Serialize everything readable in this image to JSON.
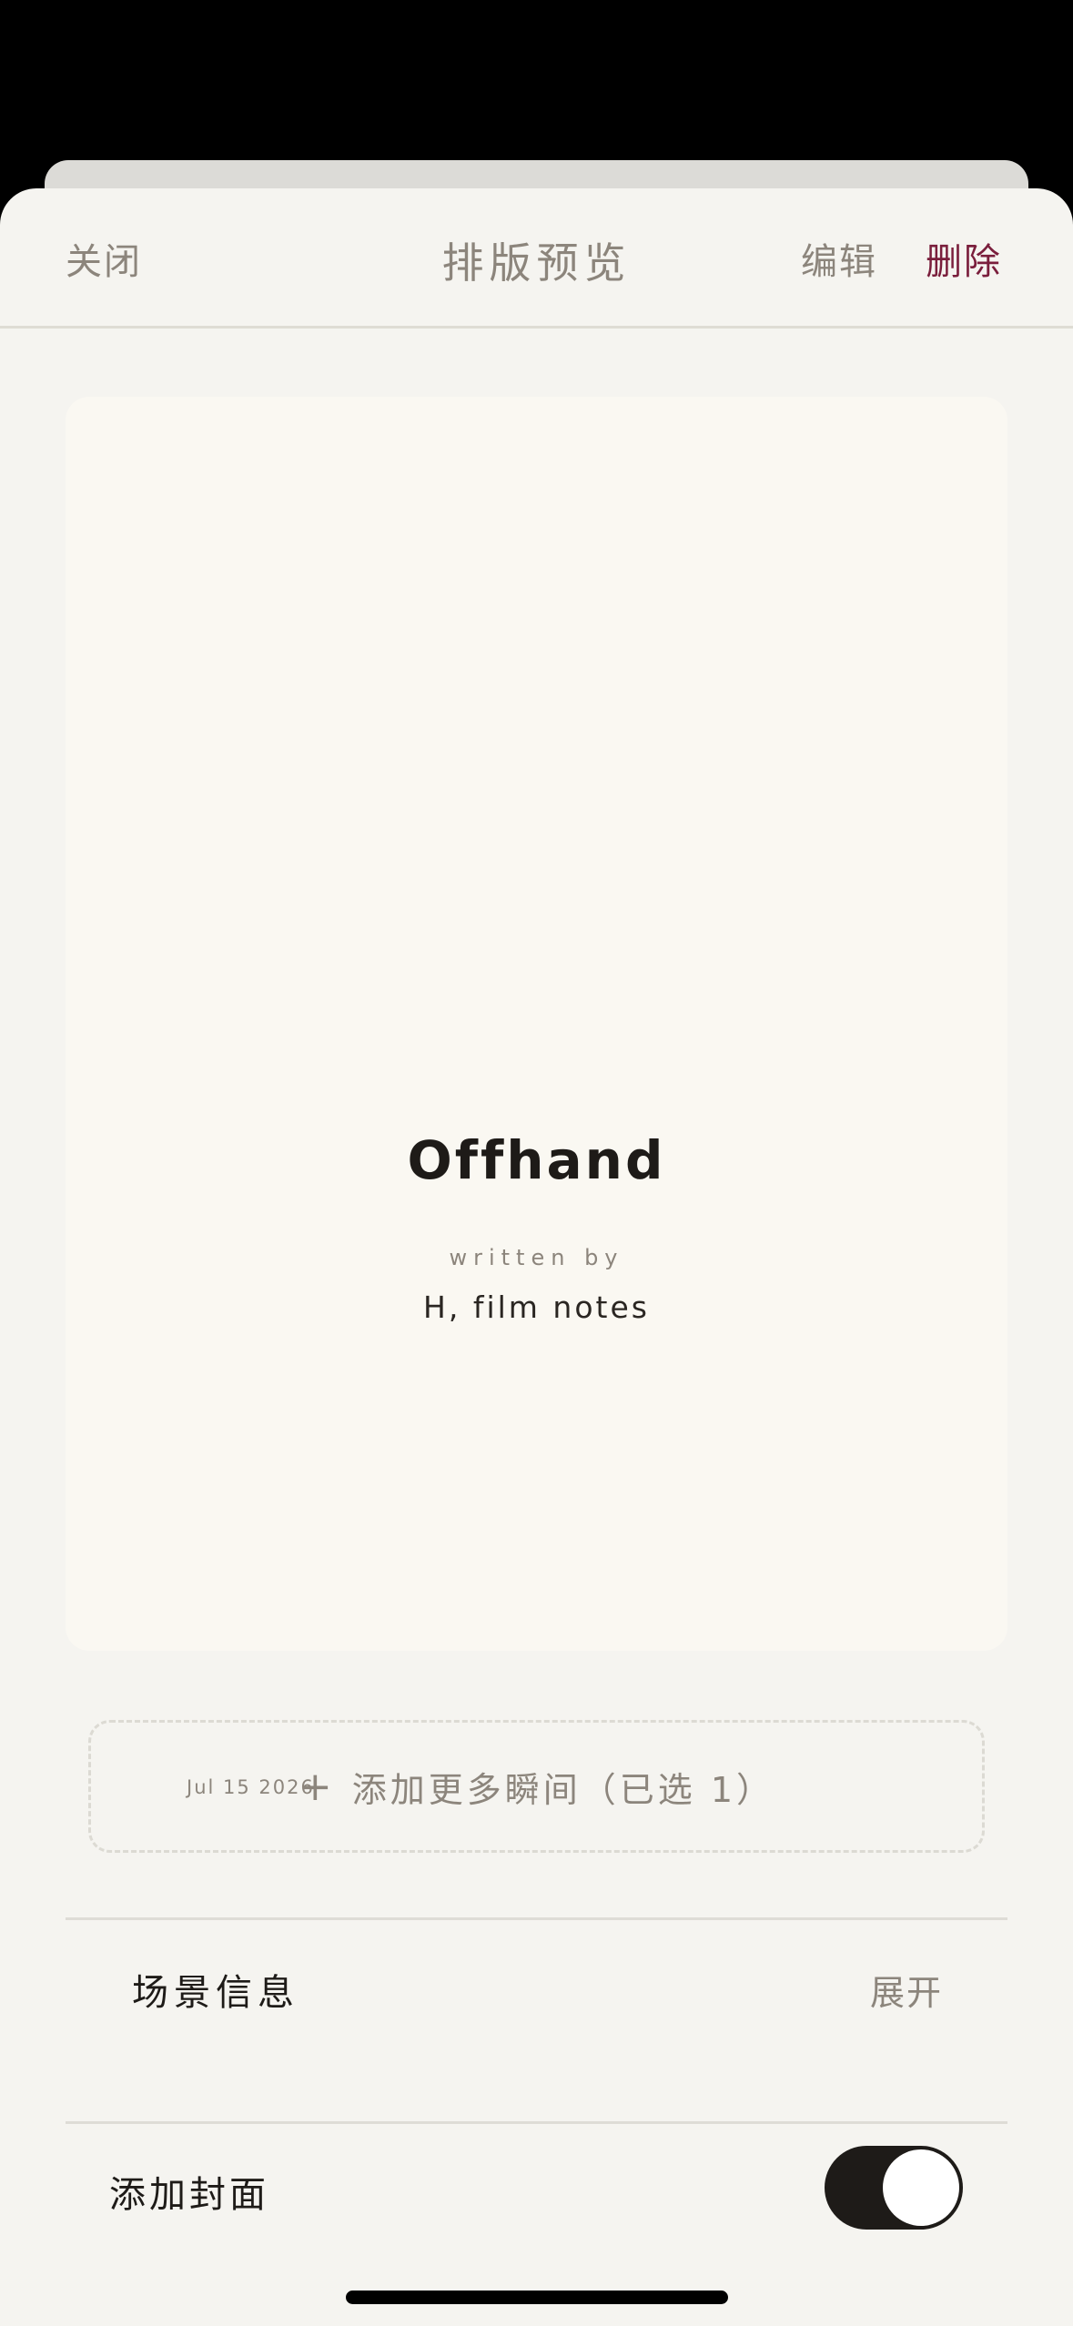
{
  "nav": {
    "close_label": "关闭",
    "title": "排版预览",
    "edit_label": "编辑",
    "delete_label": "删除",
    "delete_color": "#7a1e3c"
  },
  "preview": {
    "title": "Offhand",
    "written_by": "written by",
    "author": "H, film notes",
    "date": "Jul 15 2026"
  },
  "add_moments": {
    "icon": "plus-icon",
    "label": "添加更多瞬间（已选 1）"
  },
  "scene_info": {
    "label": "场景信息",
    "expand_label": "展开"
  },
  "cover": {
    "label": "添加封面",
    "toggle_on": true
  }
}
